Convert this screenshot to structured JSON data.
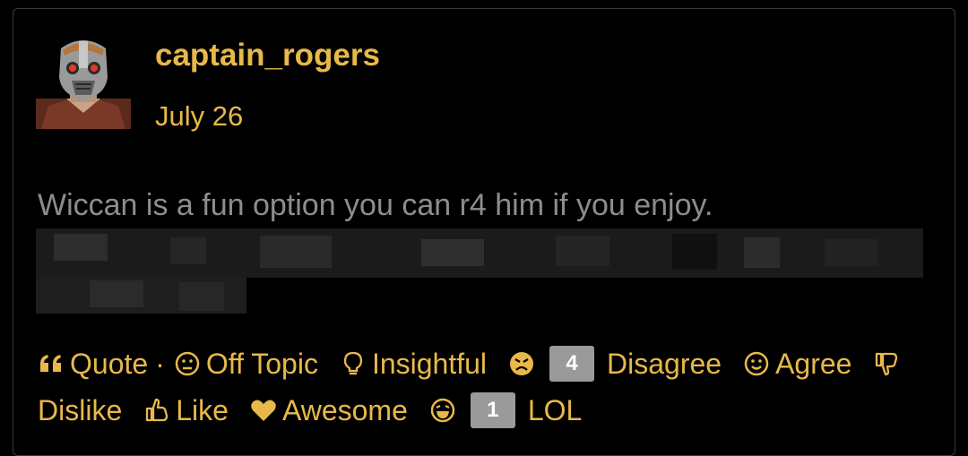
{
  "post": {
    "username": "captain_rogers",
    "date": "July 26",
    "body": "Wiccan is a fun option you can r4 him if you enjoy."
  },
  "reactions": {
    "quote": {
      "label": "Quote",
      "icon": "quote-icon"
    },
    "separator": "·",
    "off_topic": {
      "label": "Off Topic",
      "icon": "neutral-face-icon"
    },
    "insightful": {
      "label": "Insightful",
      "icon": "lightbulb-icon"
    },
    "disagree": {
      "label": "Disagree",
      "icon": "angry-face-icon",
      "count": "4"
    },
    "agree": {
      "label": "Agree",
      "icon": "smile-face-icon"
    },
    "dislike": {
      "label": "Dislike",
      "icon": "thumbs-down-icon"
    },
    "like": {
      "label": "Like",
      "icon": "thumbs-up-icon"
    },
    "awesome": {
      "label": "Awesome",
      "icon": "heart-icon"
    },
    "lol": {
      "label": "LOL",
      "icon": "laughing-face-icon",
      "count": "1"
    }
  },
  "colors": {
    "accent": "#e8b949",
    "body_text": "#8d8d8d",
    "badge": "#9a9a9a",
    "background": "#000000"
  }
}
